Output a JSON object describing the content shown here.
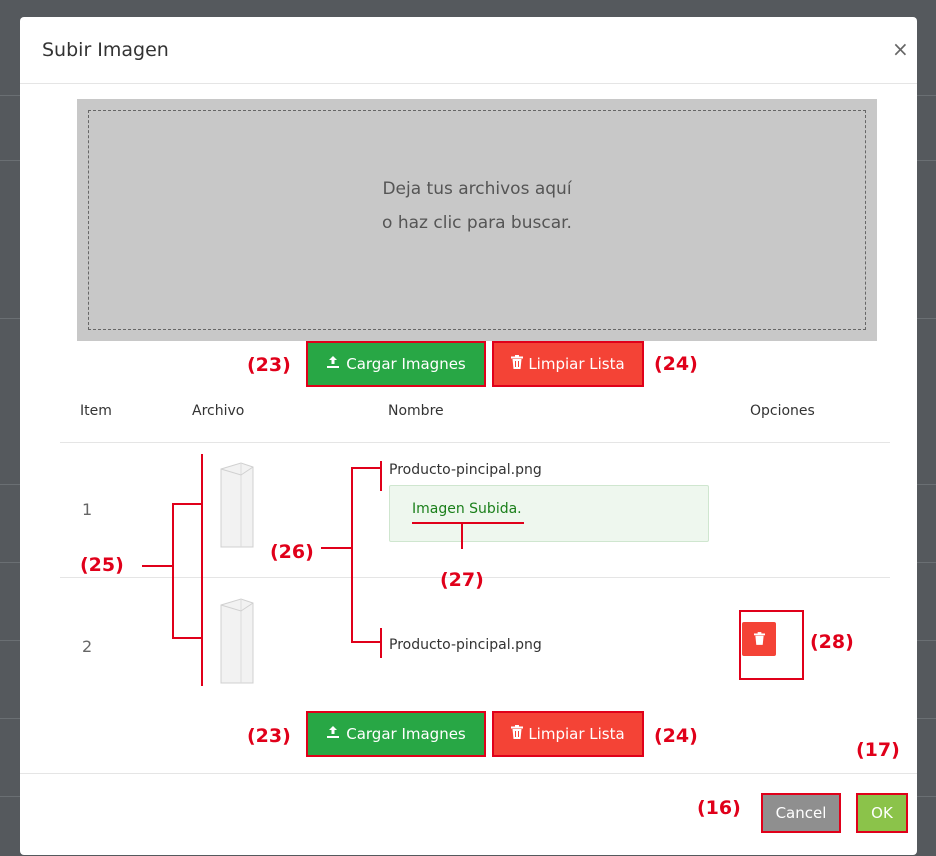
{
  "modal": {
    "title": "Subir Imagen",
    "close_label": "×"
  },
  "dropzone": {
    "line1": "Deja tus archivos aquí",
    "line2": "o haz clic para buscar."
  },
  "buttons": {
    "upload_label": "Cargar Imagnes",
    "clear_label": "Limpiar Lista",
    "cancel_label": "Cancel",
    "ok_label": "OK"
  },
  "table": {
    "headers": [
      "Item",
      "Archivo",
      "Nombre",
      "Opciones"
    ],
    "rows": [
      {
        "item": "1",
        "name": "Producto-pincipal.png",
        "status": "Imagen Subida."
      },
      {
        "item": "2",
        "name": "Producto-pincipal.png"
      }
    ]
  },
  "annotations": {
    "a23": "(23)",
    "a24": "(24)",
    "a25": "(25)",
    "a26": "(26)",
    "a27": "(27)",
    "a28": "(28)",
    "a16": "(16)",
    "a17": "(17)"
  },
  "colors": {
    "upload_button": "#28a745",
    "clear_button": "#f44336",
    "ok_button": "#8bc34a",
    "cancel_button": "#8f8f8f",
    "annotation": "#e0001a"
  },
  "icons": {
    "upload": "upload-icon",
    "trash": "trash-icon",
    "close": "close-icon"
  }
}
